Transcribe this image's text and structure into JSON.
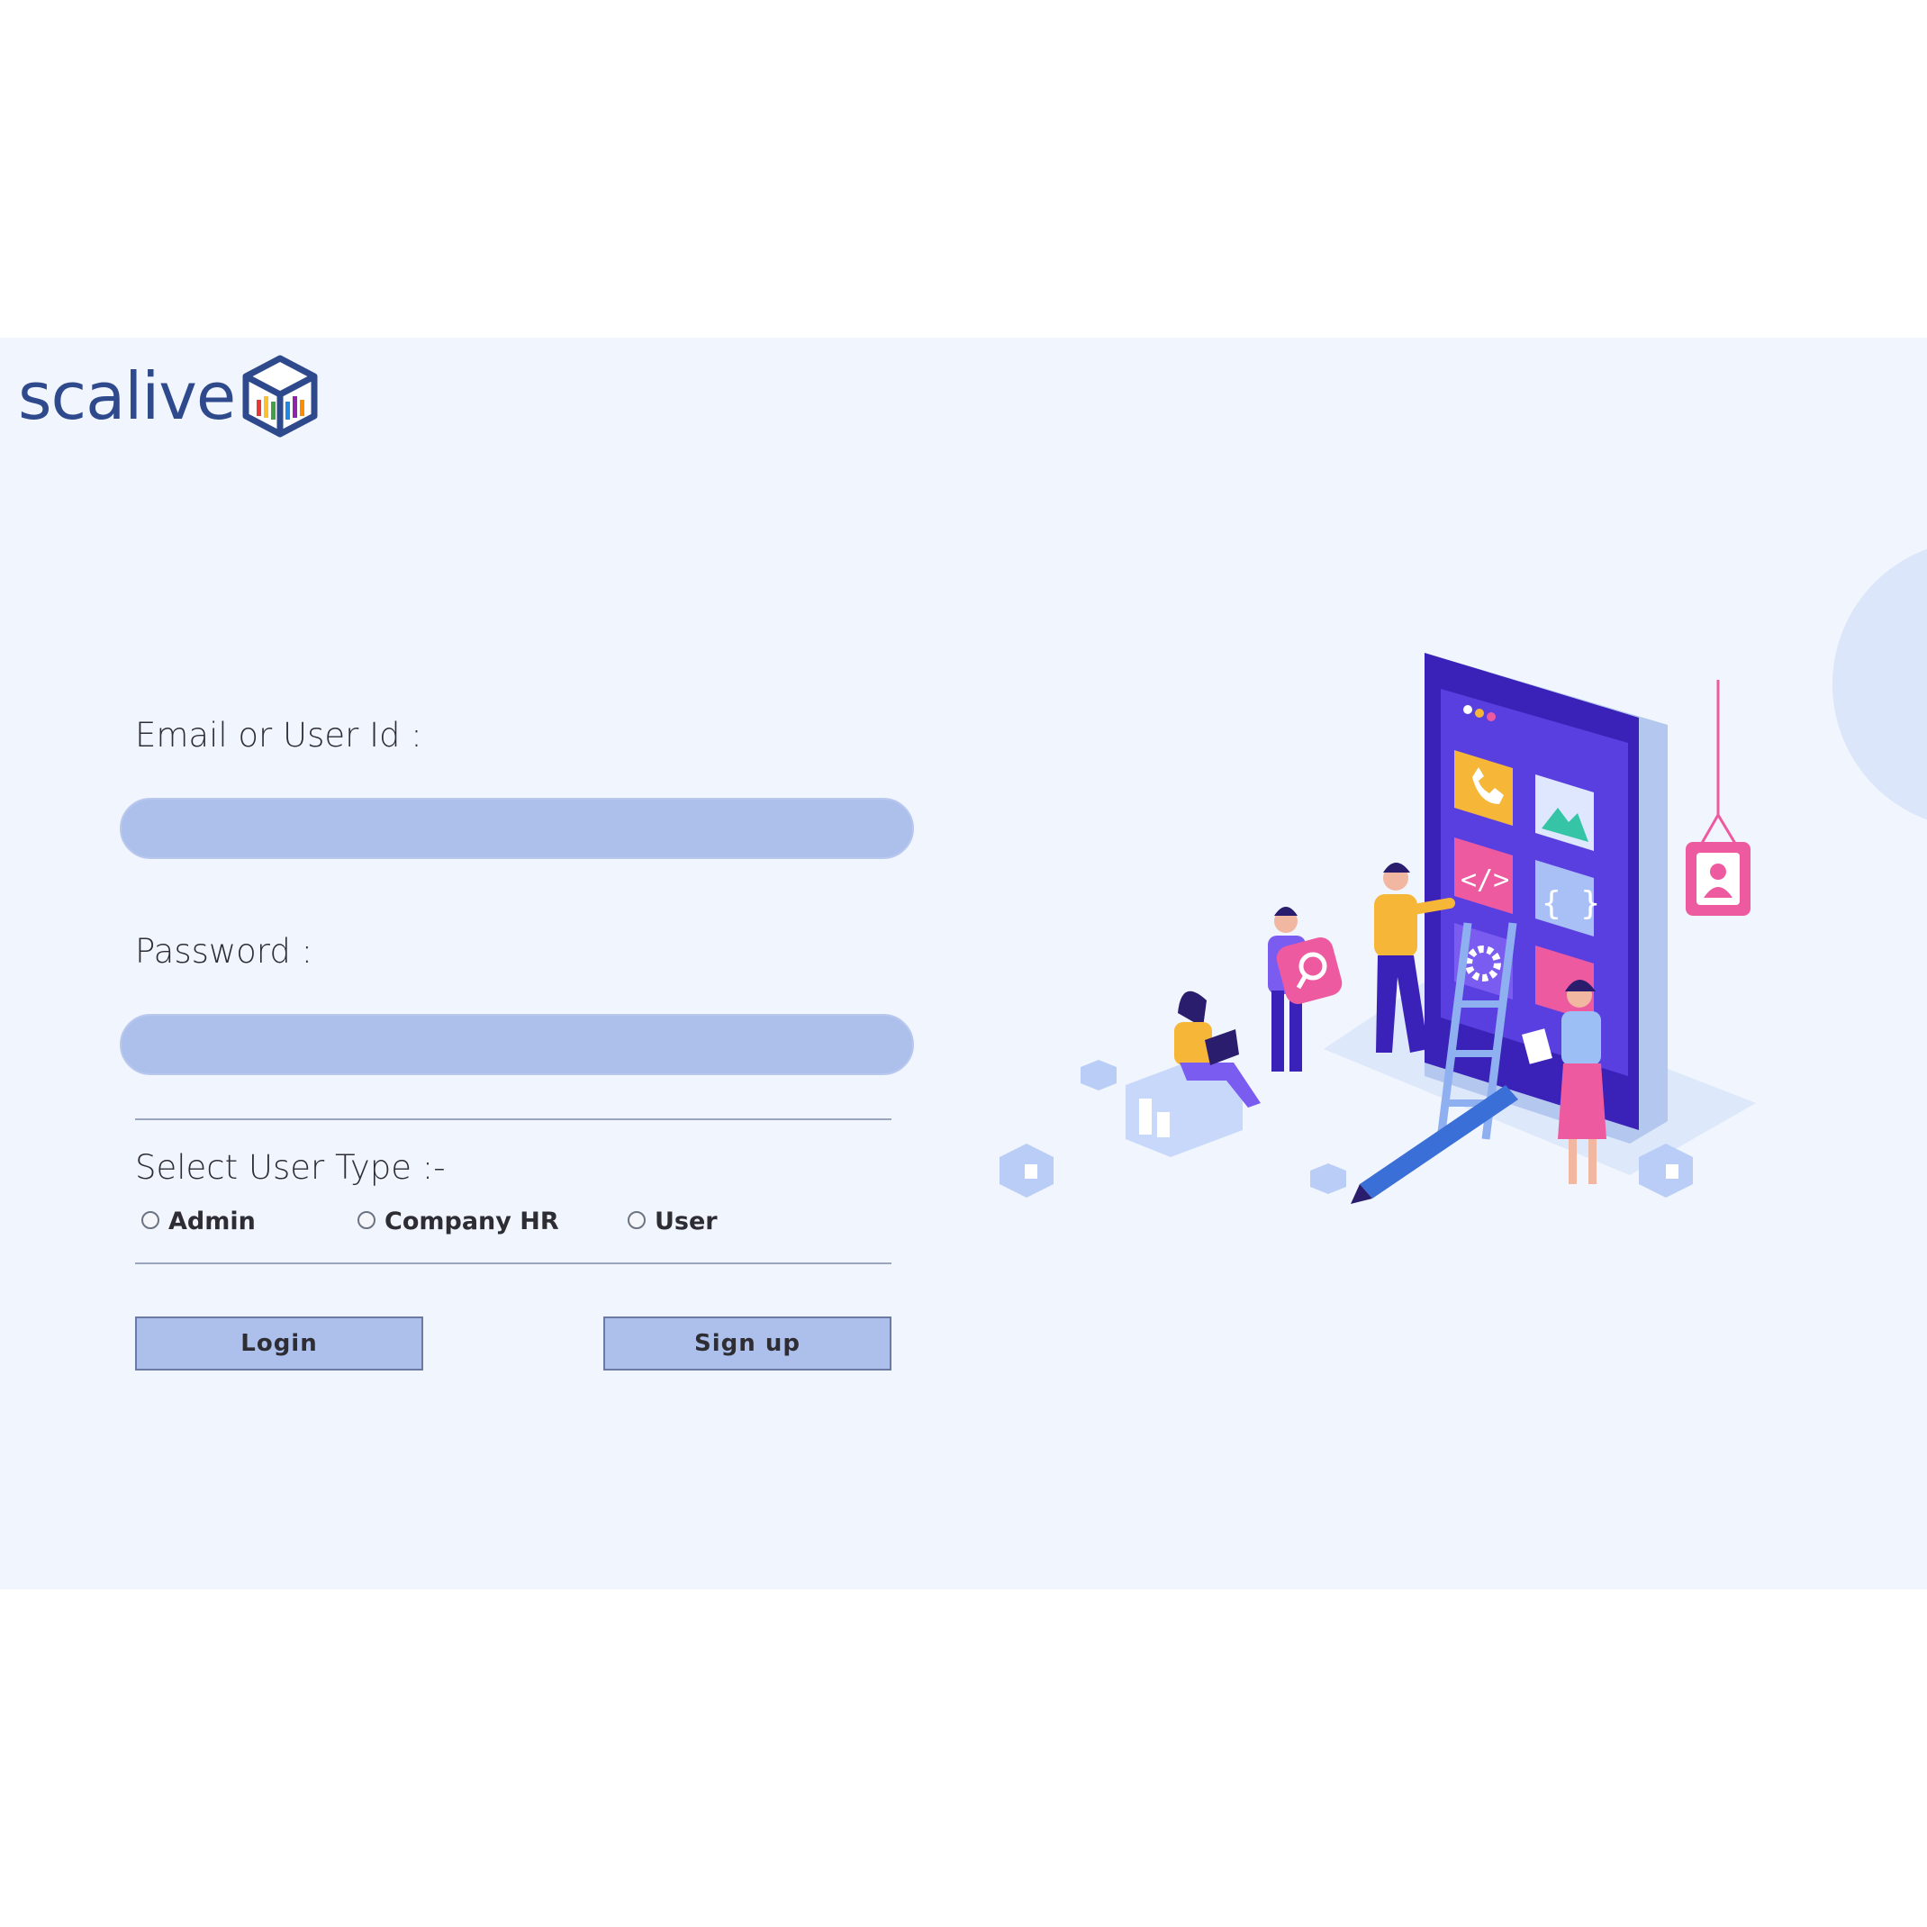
{
  "brand": {
    "name": "scalive"
  },
  "form": {
    "email_label": "Email or User Id :",
    "email_value": "",
    "password_label": "Password :",
    "password_value": "",
    "user_type_label": "Select User Type :-",
    "user_types": [
      {
        "label": "Admin",
        "selected": false
      },
      {
        "label": "Company HR",
        "selected": false
      },
      {
        "label": "User",
        "selected": false
      }
    ],
    "login_label": "Login",
    "signup_label": "Sign up"
  },
  "colors": {
    "page_bg": "#f1f5fd",
    "field_fill": "#adc0eb",
    "brand": "#2f4a8c",
    "illustration_purple": "#4a2fd0",
    "illustration_pink": "#ee5aa0",
    "illustration_yellow": "#f6b637"
  },
  "illustration": {
    "subject": "people building a mobile app",
    "icons": [
      "phone-icon",
      "image-icon",
      "code-icon",
      "braces-icon",
      "gear-icon",
      "contact-card-icon",
      "magnifier-icon",
      "pencil-icon",
      "ladder"
    ]
  }
}
